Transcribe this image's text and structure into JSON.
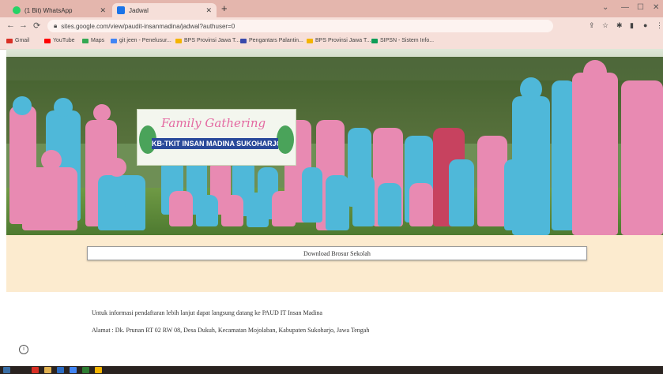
{
  "browser": {
    "tabs": [
      {
        "title": "(1 Bit) WhatsApp",
        "favicon_color": "#25d366"
      },
      {
        "title": "Jadwal",
        "favicon_color": "#1a73e8"
      }
    ],
    "new_tab": "+",
    "tab_close": "✕",
    "address": "sites.google.com/view/paudit-insanmadina/jadwal?authuser=0",
    "window": {
      "min": "—",
      "max": "☐",
      "close": "✕"
    },
    "bookmarks": [
      {
        "label": "Gmail",
        "color": "#d93025"
      },
      {
        "label": "YouTube",
        "color": "#ff0000"
      },
      {
        "label": "Maps",
        "color": "#34a853"
      },
      {
        "label": "git jeen - Penelusur...",
        "color": "#4285f4"
      },
      {
        "label": "BPS Provinsi Jawa T...",
        "color": "#f4b400"
      },
      {
        "label": "Pengantars Palantin...",
        "color": "#3949ab"
      },
      {
        "label": "BPS Provinsi Jawa T...",
        "color": "#f4b400"
      },
      {
        "label": "SIPSN - Sistem Info...",
        "color": "#0f9d58"
      }
    ]
  },
  "banner": {
    "title": "Family Gathering",
    "subtitle": "KB-TKIT INSAN MADINA SUKOHARJO"
  },
  "page": {
    "download_button": "Download Brosur Sekolah",
    "info_line": "Untuk informasi pendaftaran lebih lanjut dapat langsung datang ke PAUD IT Insan Madina",
    "address_line": "Alamat : Dk. Prunan RT 02 RW 08, Desa Dukuh, Kecamatan Mojolaban, Kabupaten Sukoharjo, Jawa Tengah",
    "info_icon": "i"
  },
  "colors": {
    "chrome_tab_bar": "#e4b6ad",
    "chrome_toolbar": "#f6dfd9",
    "cream_section": "#fcebcf",
    "uniform_blue": "#4fb8d9",
    "uniform_pink": "#e88ab2"
  }
}
